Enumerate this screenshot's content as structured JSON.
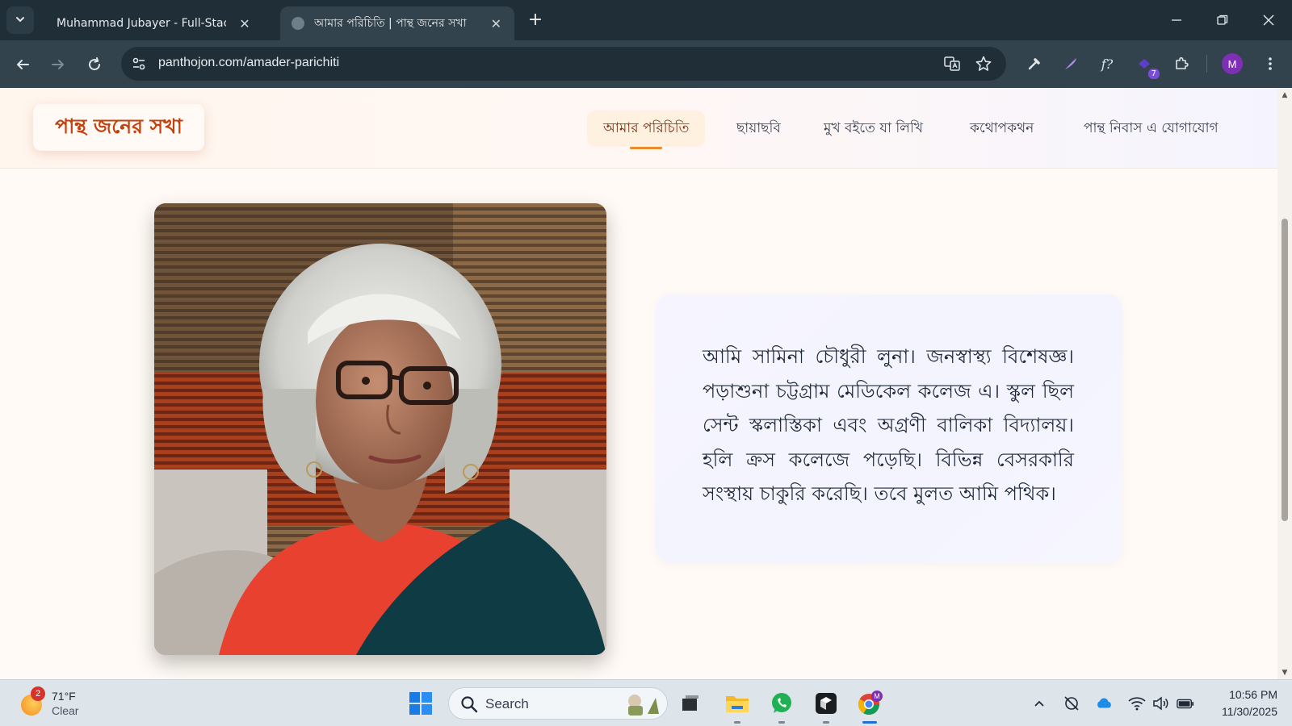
{
  "browser": {
    "tabs": [
      {
        "title": "Muhammad Jubayer - Full-Stack",
        "active": false
      },
      {
        "title": "আমার পরিচিতি | পান্থ জনের সখা",
        "active": true
      }
    ],
    "url": "panthojon.com/amader-parichiti",
    "extension_badge": "7",
    "profile_initial": "M"
  },
  "site": {
    "logo": "পান্থ জনের সখা",
    "nav": [
      {
        "label": "আমার পরিচিতি",
        "active": true
      },
      {
        "label": "ছায়াছবি",
        "active": false
      },
      {
        "label": "মুখ বইতে যা লিখি",
        "active": false
      },
      {
        "label": "কথোপকথন",
        "active": false
      },
      {
        "label": "পান্থ নিবাস এ যোগাযোগ",
        "active": false
      }
    ],
    "bio": "আমি সামিনা চৌধুরী লুনা। জনস্বাস্থ্য বিশেষজ্ঞ। পড়াশুনা চট্টগ্রাম মেডিকেল কলেজ এ। স্কুল ছিল সেন্ট স্কলাস্তিকা এবং অগ্রণী বালিকা বিদ্যালয়। হলি ক্রস কলেজে পড়েছি। বিভিন্ন বেসরকারি সংস্থায় চাকুরি করেছি। তবে মুলত আমি পথিক।",
    "accent_color": "#c2410c"
  },
  "taskbar": {
    "weather": {
      "badge": "2",
      "temp": "71°F",
      "condition": "Clear"
    },
    "search_placeholder": "Search",
    "clock": {
      "time": "10:56 PM",
      "date": "11/30/2025"
    }
  }
}
